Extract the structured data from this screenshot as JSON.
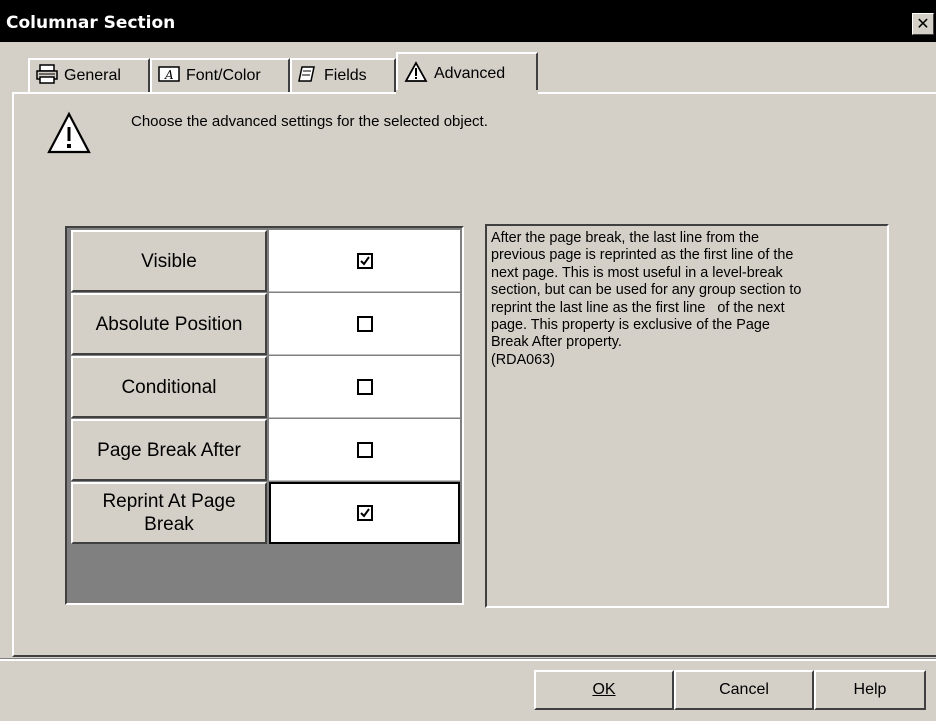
{
  "window": {
    "title": "Columnar Section",
    "close_glyph": "✕"
  },
  "tabs": [
    {
      "label": "General",
      "icon": "printer-icon"
    },
    {
      "label": "Font/Color",
      "icon": "font-icon"
    },
    {
      "label": "Fields",
      "icon": "fields-icon"
    },
    {
      "label": "Advanced",
      "icon": "warning-icon",
      "active": true
    }
  ],
  "instruction": "Choose the advanced settings for the selected object.",
  "properties": [
    {
      "label": "Visible",
      "checked": true
    },
    {
      "label": "Absolute Position",
      "checked": false
    },
    {
      "label": "Conditional",
      "checked": false
    },
    {
      "label": "Page Break After",
      "checked": false
    },
    {
      "label": "Reprint At Page Break",
      "checked": true
    }
  ],
  "description": "After the page break, the last line from the\nprevious page is reprinted as the first line of the\nnext page. This is most useful in a level-break\nsection, but can be used for any group section to\nreprint the last line as the first line   of the next\npage. This property is exclusive of the Page\nBreak After property.\n(RDA063)",
  "buttons": {
    "ok": "OK",
    "cancel": "Cancel",
    "help": "Help"
  }
}
